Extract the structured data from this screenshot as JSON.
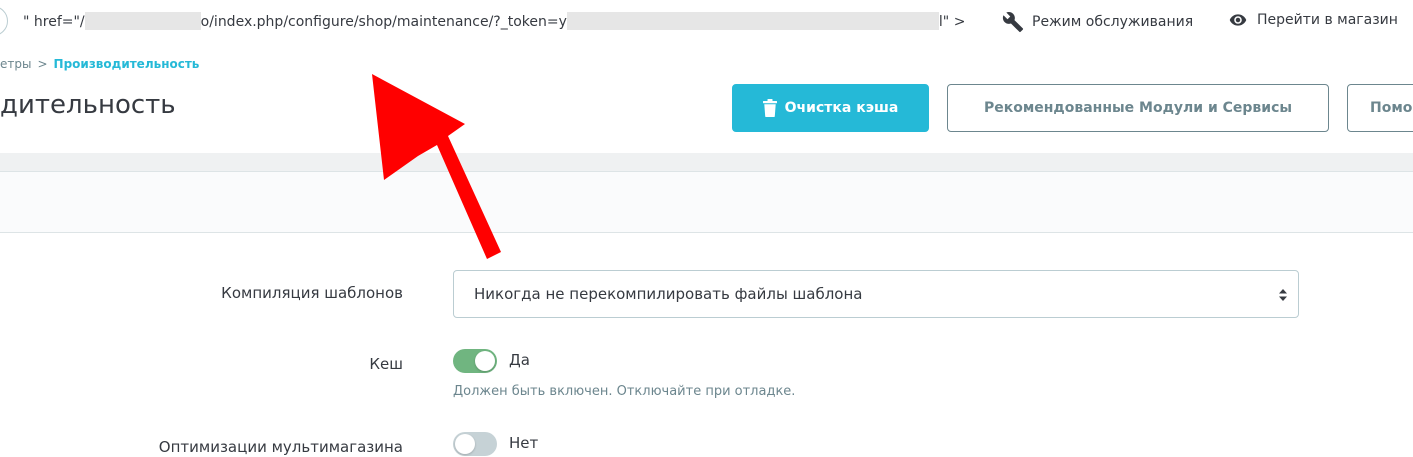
{
  "topbar": {
    "url_prefix": "\" href=\"/",
    "url_middle": "o/index.php/configure/shop/maintenance/?_token=",
    "url_prefix_after_token": "y",
    "url_suffix": "l\" >",
    "maintenance_label": "Режим обслуживания",
    "view_shop_label": "Перейти в магазин"
  },
  "breadcrumb": {
    "parent": "етры",
    "separator": ">",
    "current": "Производительность"
  },
  "header": {
    "title": "дительность",
    "clear_cache_label": "Очистка кэша",
    "recommended_label": "Рекомендованные Модули и Сервисы",
    "help_label": "Помо"
  },
  "form": {
    "template_compilation": {
      "label": "Компиляция шаблонов",
      "selected_option": "Никогда не перекомпилировать файлы шаблона"
    },
    "cache": {
      "label": "Кеш",
      "state_label": "Да",
      "enabled": true,
      "help": "Должен быть включен. Отключайте при отладке."
    },
    "multistore_optimization": {
      "label": "Оптимизации мультимагазина",
      "state_label": "Нет",
      "enabled": false
    }
  },
  "colors": {
    "primary": "#25b9d7",
    "switch_on": "#70b580",
    "switch_off": "#c6d2d6",
    "annotation_arrow": "#ff0000"
  }
}
